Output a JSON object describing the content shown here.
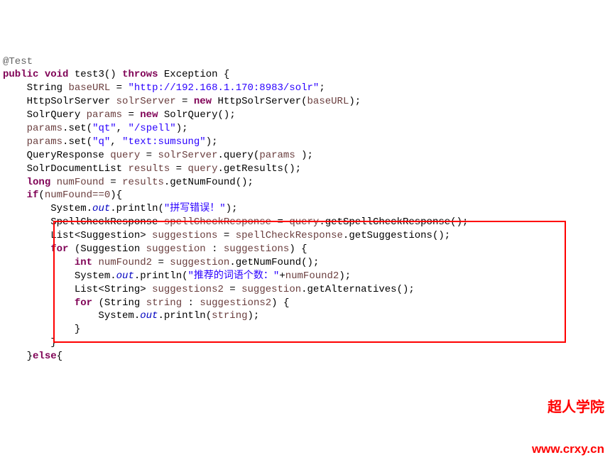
{
  "code": {
    "annotation": "@Test",
    "kw_public": "public",
    "kw_void": "void",
    "method_name": "test3",
    "kw_throws": "throws",
    "exc": "Exception",
    "l3_type": "String",
    "l3_var": "baseURL",
    "l3_str": "\"http://192.168.1.170:8983/solr\"",
    "l4_type": "HttpSolrServer",
    "l4_var": "solrServer",
    "kw_new": "new",
    "l4_ctor": "HttpSolrServer",
    "l4_arg": "baseURL",
    "l5_type": "SolrQuery",
    "l5_var": "params",
    "l5_ctor": "SolrQuery",
    "l6_obj": "params",
    "l6_mth": "set",
    "l6_a1": "\"qt\"",
    "l6_a2": "\"/spell\"",
    "l7_a1": "\"q\"",
    "l7_a2": "\"text:sumsung\"",
    "l8_type": "QueryResponse",
    "l8_var": "query",
    "l8_obj": "solrServer",
    "l8_mth": "query",
    "l8_arg": "params",
    "l9_type": "SolrDocumentList",
    "l9_var": "results",
    "l9_obj": "query",
    "l9_mth": "getResults",
    "kw_long": "long",
    "l10_var": "numFound",
    "l10_obj": "results",
    "l10_mth": "getNumFound",
    "kw_if": "if",
    "l11_cond": "numFound==0",
    "sys": "System",
    "out": "out",
    "println": "println",
    "l12_str": "\"拼写错误！\"",
    "l13_type": "SpellCheckResponse",
    "l13_var": "spellCheckResponse",
    "l13_obj": "query",
    "l13_mth": "getSpellCheckResponse",
    "l14_type": "List<Suggestion>",
    "l14_var": "suggestions",
    "l14_obj": "spellCheckResponse",
    "l14_mth": "getSuggestions",
    "kw_for": "for",
    "l15_type": "Suggestion",
    "l15_var": "suggestion",
    "l15_coll": "suggestions",
    "kw_int": "int",
    "l16_var": "numFound2",
    "l16_obj": "suggestion",
    "l16_mth": "getNumFound",
    "l17_str": "\"推荐的词语个数：\"",
    "l17_plus": "+",
    "l17_var": "numFound2",
    "l18_type": "List<String>",
    "l18_var": "suggestions2",
    "l18_obj": "suggestion",
    "l18_mth": "getAlternatives",
    "l19_type": "String",
    "l19_var": "string",
    "l19_coll": "suggestions2",
    "l20_arg": "string",
    "kw_else": "else"
  },
  "watermark": {
    "line1": "超人学院",
    "line2": "www.crxy.cn"
  }
}
